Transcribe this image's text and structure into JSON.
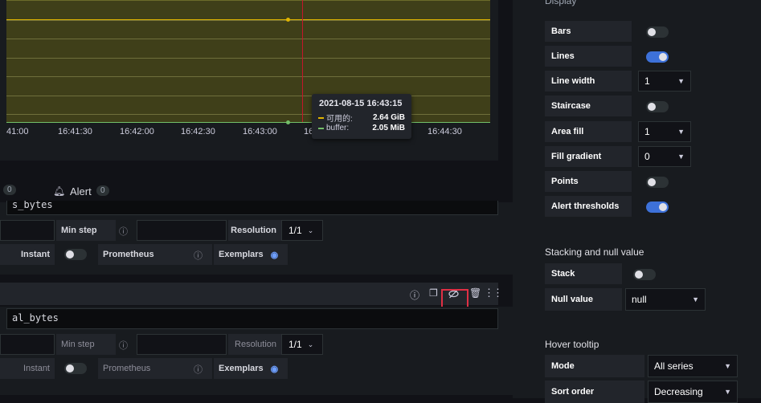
{
  "graph": {
    "x_ticks": [
      "41:00",
      "16:41:30",
      "16:42:00",
      "16:42:30",
      "16:43:00",
      "16",
      "16:44:30"
    ],
    "tooltip": {
      "time": "2021-08-15 16:43:15",
      "rows": [
        {
          "name": "可用的:",
          "value": "2.64 GiB",
          "color": "#e0b400"
        },
        {
          "name": "buffer:",
          "value": "2.05 MiB",
          "color": "#73bf69"
        }
      ]
    }
  },
  "tabs": {
    "queries_count": "0",
    "alert_label": "Alert",
    "alert_count": "0"
  },
  "query_a": {
    "expr_fragment": "s_bytes",
    "min_step": "Min step",
    "resolution": "Resolution",
    "resolution_value": "1/1",
    "instant": "Instant",
    "prometheus": "Prometheus",
    "exemplars": "Exemplars"
  },
  "query_b": {
    "expr_fragment": "al_bytes",
    "min_step": "Min step",
    "resolution": "Resolution",
    "resolution_value": "1/1",
    "instant": "Instant",
    "prometheus": "Prometheus",
    "exemplars": "Exemplars"
  },
  "options": {
    "display_header": "Display",
    "display": [
      {
        "label": "Bars",
        "type": "toggle",
        "on": false
      },
      {
        "label": "Lines",
        "type": "toggle",
        "on": true
      },
      {
        "label": "Line width",
        "type": "select",
        "value": "1"
      },
      {
        "label": "Staircase",
        "type": "toggle",
        "on": false
      },
      {
        "label": "Area fill",
        "type": "select",
        "value": "1"
      },
      {
        "label": "Fill gradient",
        "type": "select",
        "value": "0"
      },
      {
        "label": "Points",
        "type": "toggle",
        "on": false
      },
      {
        "label": "Alert thresholds",
        "type": "toggle",
        "on": true
      }
    ],
    "stacking_header": "Stacking and null value",
    "stack_label": "Stack",
    "null_value_label": "Null value",
    "null_value": "null",
    "hover_header": "Hover tooltip",
    "mode_label": "Mode",
    "mode_value": "All series",
    "sort_label": "Sort order",
    "sort_value": "Decreasing"
  },
  "colors": {
    "accent": "#3d71d9",
    "highlight": "#e02f44",
    "series_yellow": "#e0b400",
    "series_green": "#73bf69"
  }
}
